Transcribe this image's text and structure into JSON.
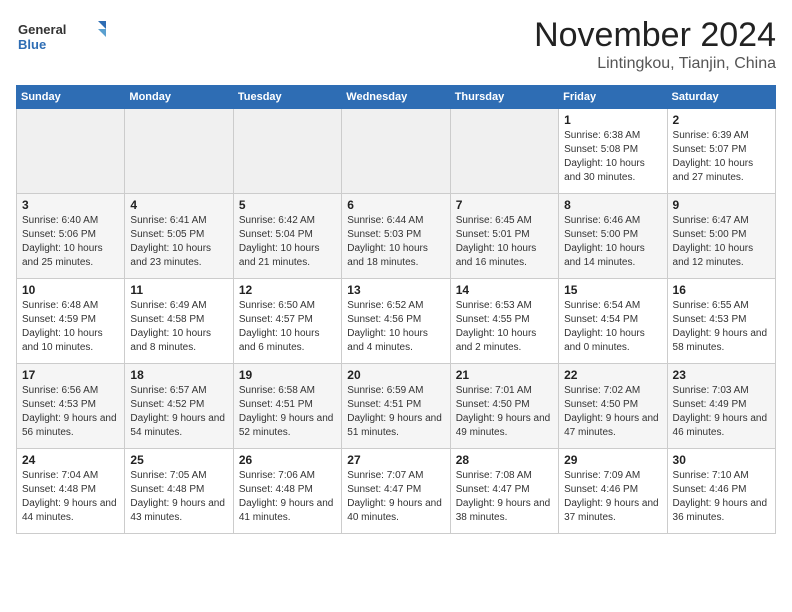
{
  "header": {
    "logo_general": "General",
    "logo_blue": "Blue",
    "title": "November 2024",
    "subtitle": "Lintingkou, Tianjin, China"
  },
  "calendar": {
    "days_of_week": [
      "Sunday",
      "Monday",
      "Tuesday",
      "Wednesday",
      "Thursday",
      "Friday",
      "Saturday"
    ],
    "weeks": [
      [
        {
          "day": "",
          "info": ""
        },
        {
          "day": "",
          "info": ""
        },
        {
          "day": "",
          "info": ""
        },
        {
          "day": "",
          "info": ""
        },
        {
          "day": "",
          "info": ""
        },
        {
          "day": "1",
          "info": "Sunrise: 6:38 AM\nSunset: 5:08 PM\nDaylight: 10 hours and 30 minutes."
        },
        {
          "day": "2",
          "info": "Sunrise: 6:39 AM\nSunset: 5:07 PM\nDaylight: 10 hours and 27 minutes."
        }
      ],
      [
        {
          "day": "3",
          "info": "Sunrise: 6:40 AM\nSunset: 5:06 PM\nDaylight: 10 hours and 25 minutes."
        },
        {
          "day": "4",
          "info": "Sunrise: 6:41 AM\nSunset: 5:05 PM\nDaylight: 10 hours and 23 minutes."
        },
        {
          "day": "5",
          "info": "Sunrise: 6:42 AM\nSunset: 5:04 PM\nDaylight: 10 hours and 21 minutes."
        },
        {
          "day": "6",
          "info": "Sunrise: 6:44 AM\nSunset: 5:03 PM\nDaylight: 10 hours and 18 minutes."
        },
        {
          "day": "7",
          "info": "Sunrise: 6:45 AM\nSunset: 5:01 PM\nDaylight: 10 hours and 16 minutes."
        },
        {
          "day": "8",
          "info": "Sunrise: 6:46 AM\nSunset: 5:00 PM\nDaylight: 10 hours and 14 minutes."
        },
        {
          "day": "9",
          "info": "Sunrise: 6:47 AM\nSunset: 5:00 PM\nDaylight: 10 hours and 12 minutes."
        }
      ],
      [
        {
          "day": "10",
          "info": "Sunrise: 6:48 AM\nSunset: 4:59 PM\nDaylight: 10 hours and 10 minutes."
        },
        {
          "day": "11",
          "info": "Sunrise: 6:49 AM\nSunset: 4:58 PM\nDaylight: 10 hours and 8 minutes."
        },
        {
          "day": "12",
          "info": "Sunrise: 6:50 AM\nSunset: 4:57 PM\nDaylight: 10 hours and 6 minutes."
        },
        {
          "day": "13",
          "info": "Sunrise: 6:52 AM\nSunset: 4:56 PM\nDaylight: 10 hours and 4 minutes."
        },
        {
          "day": "14",
          "info": "Sunrise: 6:53 AM\nSunset: 4:55 PM\nDaylight: 10 hours and 2 minutes."
        },
        {
          "day": "15",
          "info": "Sunrise: 6:54 AM\nSunset: 4:54 PM\nDaylight: 10 hours and 0 minutes."
        },
        {
          "day": "16",
          "info": "Sunrise: 6:55 AM\nSunset: 4:53 PM\nDaylight: 9 hours and 58 minutes."
        }
      ],
      [
        {
          "day": "17",
          "info": "Sunrise: 6:56 AM\nSunset: 4:53 PM\nDaylight: 9 hours and 56 minutes."
        },
        {
          "day": "18",
          "info": "Sunrise: 6:57 AM\nSunset: 4:52 PM\nDaylight: 9 hours and 54 minutes."
        },
        {
          "day": "19",
          "info": "Sunrise: 6:58 AM\nSunset: 4:51 PM\nDaylight: 9 hours and 52 minutes."
        },
        {
          "day": "20",
          "info": "Sunrise: 6:59 AM\nSunset: 4:51 PM\nDaylight: 9 hours and 51 minutes."
        },
        {
          "day": "21",
          "info": "Sunrise: 7:01 AM\nSunset: 4:50 PM\nDaylight: 9 hours and 49 minutes."
        },
        {
          "day": "22",
          "info": "Sunrise: 7:02 AM\nSunset: 4:50 PM\nDaylight: 9 hours and 47 minutes."
        },
        {
          "day": "23",
          "info": "Sunrise: 7:03 AM\nSunset: 4:49 PM\nDaylight: 9 hours and 46 minutes."
        }
      ],
      [
        {
          "day": "24",
          "info": "Sunrise: 7:04 AM\nSunset: 4:48 PM\nDaylight: 9 hours and 44 minutes."
        },
        {
          "day": "25",
          "info": "Sunrise: 7:05 AM\nSunset: 4:48 PM\nDaylight: 9 hours and 43 minutes."
        },
        {
          "day": "26",
          "info": "Sunrise: 7:06 AM\nSunset: 4:48 PM\nDaylight: 9 hours and 41 minutes."
        },
        {
          "day": "27",
          "info": "Sunrise: 7:07 AM\nSunset: 4:47 PM\nDaylight: 9 hours and 40 minutes."
        },
        {
          "day": "28",
          "info": "Sunrise: 7:08 AM\nSunset: 4:47 PM\nDaylight: 9 hours and 38 minutes."
        },
        {
          "day": "29",
          "info": "Sunrise: 7:09 AM\nSunset: 4:46 PM\nDaylight: 9 hours and 37 minutes."
        },
        {
          "day": "30",
          "info": "Sunrise: 7:10 AM\nSunset: 4:46 PM\nDaylight: 9 hours and 36 minutes."
        }
      ]
    ]
  }
}
